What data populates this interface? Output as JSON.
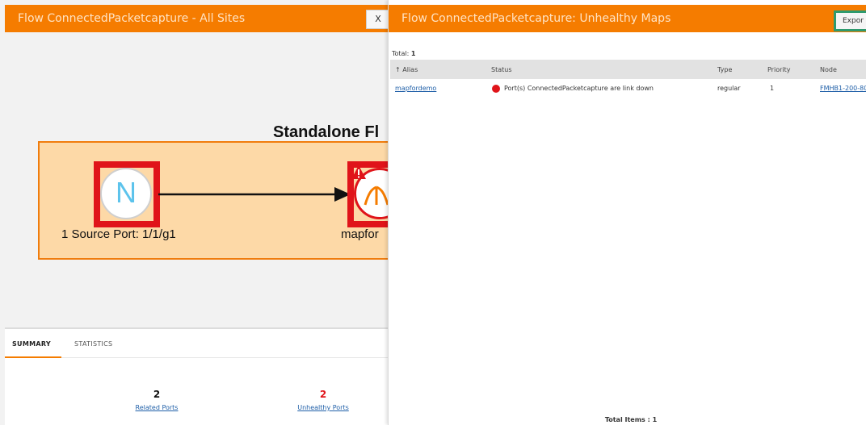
{
  "left_panel": {
    "title": "Flow ConnectedPacketcapture - All Sites",
    "close_label": "X",
    "diagram": {
      "title": "Standalone Fl",
      "source_node_letter": "N",
      "source_label": "1 Source Port: 1/1/g1",
      "map_label": "mapfor"
    },
    "tabs": [
      {
        "label": "SUMMARY",
        "active": true
      },
      {
        "label": "STATISTICS",
        "active": false
      }
    ],
    "stats": [
      {
        "value": "2",
        "label": "Related Ports"
      },
      {
        "value": "2",
        "label": "Unhealthy Ports"
      }
    ]
  },
  "right_panel": {
    "title": "Flow ConnectedPacketcapture: Unhealthy Maps",
    "export_label": "Expor",
    "total_prefix": "Total: ",
    "total_value": "1",
    "columns": [
      "↑ Alias",
      "Status",
      "Type",
      "Priority",
      "Node"
    ],
    "rows": [
      {
        "alias": "mapfordemo",
        "status": "Port(s) ConnectedPacketcapture are link down",
        "type": "regular",
        "priority": "1",
        "node": "FMHB1-200-80"
      }
    ],
    "footer": "Total Items : 1"
  },
  "colors": {
    "header_orange": "#f57c00",
    "alert_red": "#e0141a",
    "link_blue": "#1f5fa8",
    "flow_box_fill": "#fdd9a7",
    "export_border_green": "#2e9a6e"
  },
  "icons": [
    "close-icon",
    "warning-icon",
    "map-icon",
    "status-dot-icon",
    "sort-up-icon"
  ]
}
